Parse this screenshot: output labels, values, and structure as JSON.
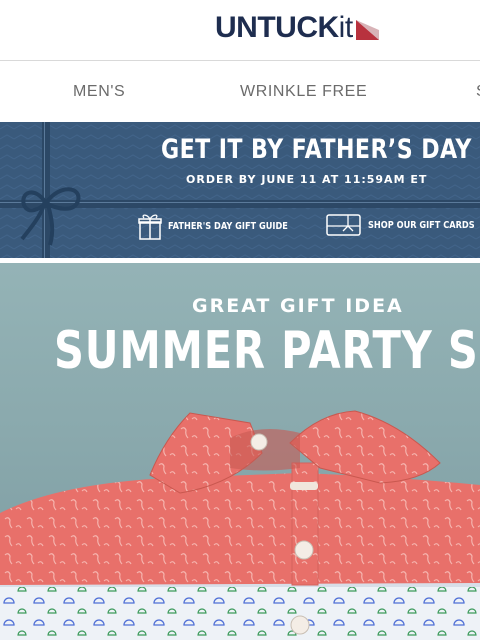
{
  "brand": {
    "name_main": "UNTUCK",
    "name_tail": "it",
    "colors": {
      "navy": "#1e2d4f",
      "red": "#b8323e"
    }
  },
  "nav": {
    "items": [
      {
        "label": "MEN'S"
      },
      {
        "label": "WRINKLE FREE"
      },
      {
        "label": "S"
      }
    ]
  },
  "promo_banner": {
    "title": "GET IT BY FATHER’S DAY",
    "subtitle": "ORDER BY JUNE 11 AT 11:59AM ET",
    "links": [
      {
        "label": "FATHER'S DAY GIFT GUIDE",
        "icon": "gift-icon"
      },
      {
        "label": "SHOP OUR GIFT CARDS",
        "icon": "gift-card-icon"
      }
    ],
    "colors": {
      "background": "#3a5a7c",
      "ribbon": "#2c4866"
    }
  },
  "hero": {
    "kicker": "GREAT GIFT IDEA",
    "title": "SUMMER PARTY SHIR",
    "colors": {
      "background": "#8fadb0",
      "shirt": "#e8706a"
    }
  }
}
